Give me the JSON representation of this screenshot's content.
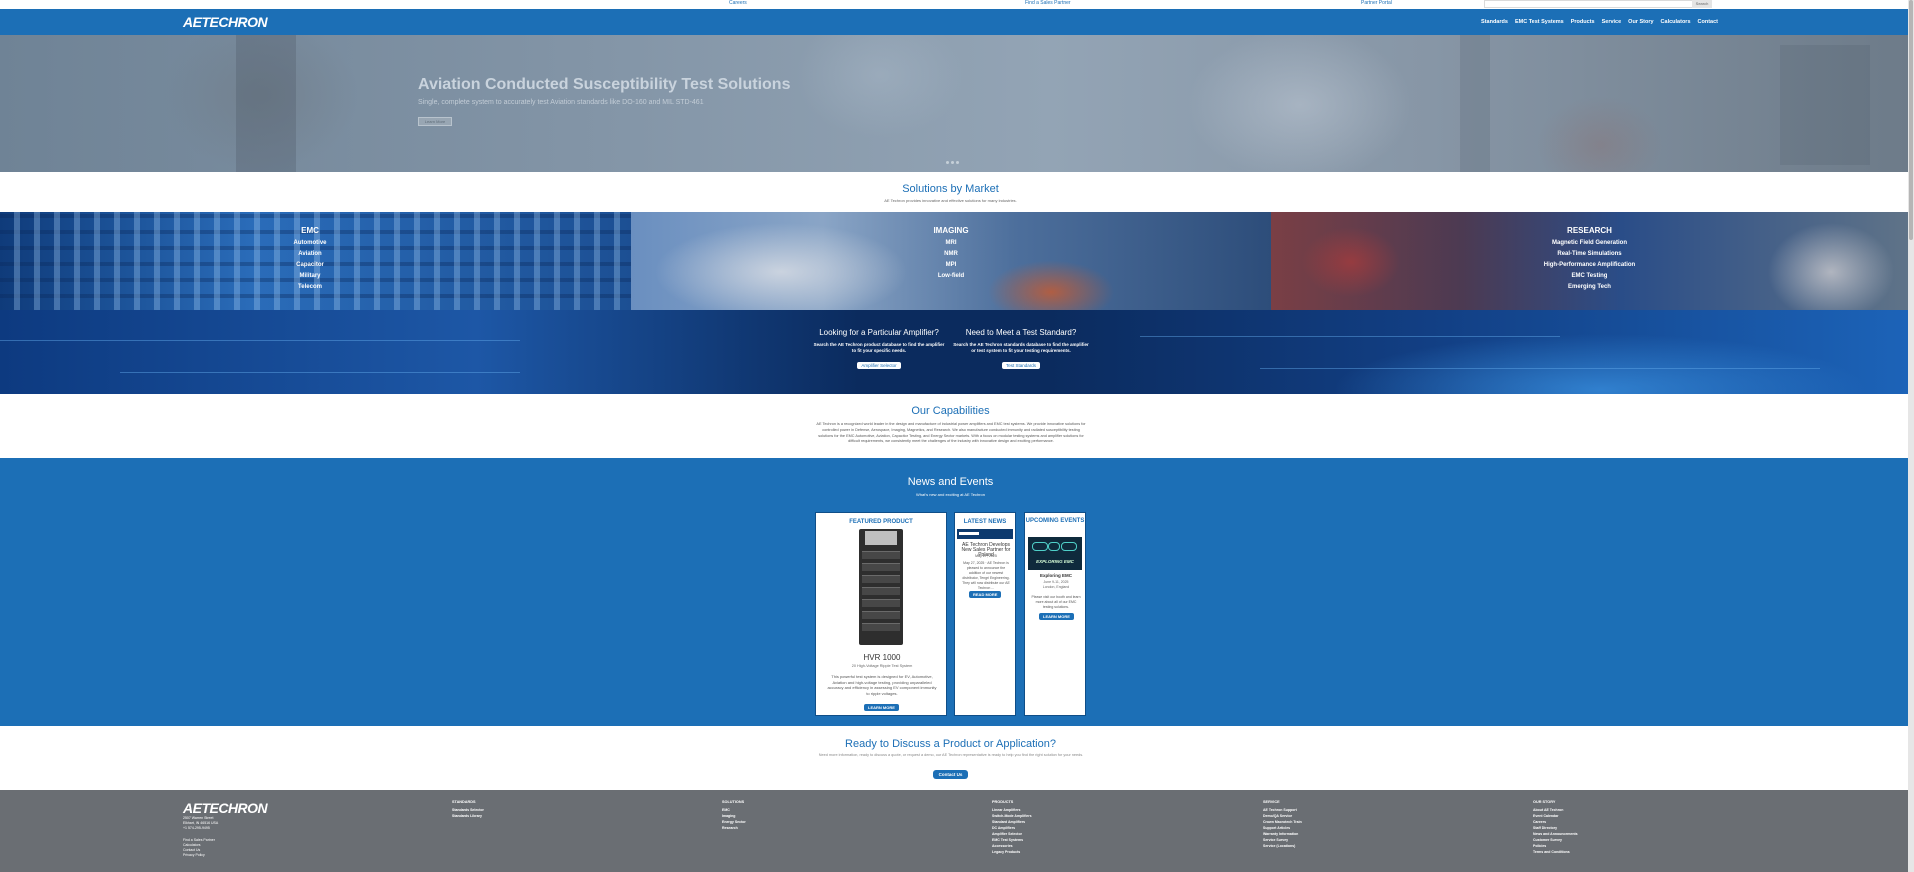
{
  "utility": {
    "links": [
      "Careers",
      "Find a Sales Partner",
      "Partner Portal"
    ],
    "search_button": "Search"
  },
  "nav": {
    "logo": "AETECHRON",
    "links": [
      "Standards",
      "EMC Test Systems",
      "Products",
      "Service",
      "Our Story",
      "Calculators",
      "Contact"
    ]
  },
  "hero": {
    "title": "Aviation Conducted Susceptibility Test Solutions",
    "subtitle": "Single, complete system to accurately test Aviation standards like DO-160 and MIL STD-461",
    "button": "Learn More",
    "slide_count": 3,
    "active_slide": 1
  },
  "solutions": {
    "title": "Solutions by Market",
    "subtitle": "AE Techron provides innovative and effective solutions for many industries.",
    "markets": [
      {
        "title": "EMC",
        "links": [
          "Automotive",
          "Aviation",
          "Capacitor",
          "Military",
          "Telecom"
        ]
      },
      {
        "title": "IMAGING",
        "links": [
          "MRI",
          "NMR",
          "MPI",
          "Low-field"
        ]
      },
      {
        "title": "RESEARCH",
        "links": [
          "Magnetic Field Generation",
          "Real-Time Simulations",
          "High-Performance Amplification",
          "EMC Testing",
          "Emerging Tech"
        ]
      }
    ]
  },
  "search_band": {
    "amplifier": {
      "title": "Looking for a Particular Amplifier?",
      "text": "Search the AE Techron product database to find the amplifier to fit your specific needs.",
      "button": "Amplifier Selector"
    },
    "standard": {
      "title": "Need to Meet a Test Standard?",
      "text": "Search the AE Techron standards database to find the amplifier or test system to fit your testing requirements.",
      "button": "Test Standards"
    }
  },
  "capabilities": {
    "title": "Our Capabilities",
    "text": "AE Techron is a recognized world leader in the design and manufacture of industrial power amplifiers and EMC test systems. We provide innovative solutions for controlled power in Defense, Aerospace, Imaging, Magnetics, and Research. We also manufacture conducted immunity and radiated susceptibility testing solutions for the EMC Automotive, Aviation, Capacitor Testing, and Energy Sector markets. With a focus on modular testing systems and amplifier solutions for difficult requirements, we consistently meet the challenges of the industry with innovative design and exciting performance."
  },
  "news": {
    "title": "News and Events",
    "subtitle": "What's new and exciting at AE Techron",
    "featured": {
      "head": "FEATURED PRODUCT",
      "name": "HVR 1000",
      "category": "20 High-Voltage Ripple Test System",
      "text": "This powerful test system is designed for EV, Automotive, Aviation and high-voltage testing, providing unparalleled accuracy and efficiency in assessing EV component immunity to ripple voltages.",
      "button": "LEARN MORE"
    },
    "latest": {
      "head": "LATEST NEWS",
      "headline": "AE Techron Develops New Sales Partner for Poland",
      "date": "May 27, 2025",
      "text": "May 27, 2025 · AE Techron is pleased to announce the addition of our newest distributor, Tengri Engineering. They will now distribute our AE Techron ...",
      "button": "READ MORE"
    },
    "events": {
      "head": "UPCOMING EVENTS",
      "image_caption": "EXPLORING EMC",
      "name": "Exploring EMC",
      "date": "June 9-11, 2025",
      "location": "London, England",
      "text": "Please visit our booth and learn more about all of our EMC testing solutions.",
      "button": "LEARN MORE"
    }
  },
  "cta": {
    "title": "Ready to Discuss a Product or Application?",
    "text": "Need more information, ready to discuss a quote, or request a demo, our AE Techron representative is ready to help you find the right solution for your needs.",
    "button": "Contact Us"
  },
  "footer": {
    "logo": "AETECHRON",
    "address": [
      "2507 Warren Street",
      "Elkhart, IN 46516 USA",
      "+1 574-295-9495"
    ],
    "left_links": [
      "Find a Sales Partner",
      "Calculators",
      "Contact Us",
      "Privacy Policy"
    ],
    "columns": [
      {
        "head": "STANDARDS",
        "items": [
          "Standards Selector",
          "Standards Library"
        ]
      },
      {
        "head": "SOLUTIONS",
        "items": [
          "EMC",
          "Imaging",
          "Energy Sector",
          "Research"
        ]
      },
      {
        "head": "PRODUCTS",
        "items": [
          "Linear Amplifiers",
          "Switch-Mode Amplifiers",
          "Standard Amplifiers",
          "DC Amplifiers",
          "Amplifier Selector",
          "EMC Test Systems",
          "Accessories",
          "Legacy Products"
        ]
      },
      {
        "head": "SERVICE",
        "items": [
          "AE Techron Support",
          "Demo/QA Service",
          "Crown Macrotech Train",
          "Support Articles",
          "Warranty Information",
          "Service Survey",
          "Service (Locations)"
        ]
      },
      {
        "head": "OUR STORY",
        "items": [
          "About AE Techron",
          "Event Calendar",
          "Careers",
          "Staff Directory",
          "News and Announcements",
          "Customer Survey",
          "Policies",
          "Terms and Conditions"
        ]
      }
    ]
  },
  "colors": {
    "brand_blue": "#1c6fb6",
    "footer_gray": "#6a6e73",
    "white": "#ffffff"
  }
}
